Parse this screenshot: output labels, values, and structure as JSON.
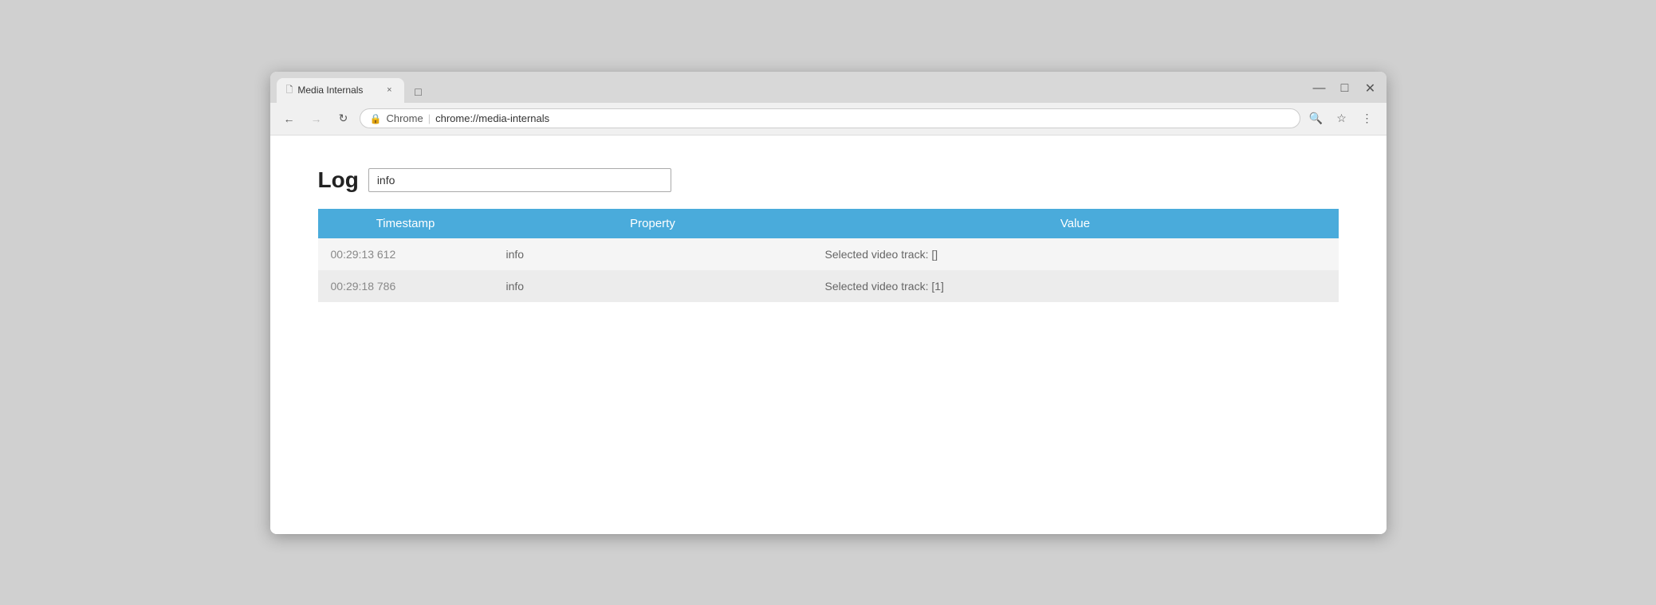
{
  "browser": {
    "title": "Media Internals",
    "url": "chrome://media-internals",
    "url_prefix": "Chrome",
    "tab_close": "×",
    "minimize": "—",
    "maximize": "□",
    "close": "✕"
  },
  "nav": {
    "back_label": "←",
    "forward_label": "→",
    "reload_label": "↻",
    "search_icon": "🔍",
    "star_icon": "☆",
    "menu_icon": "⋮",
    "secure_icon": "🔒"
  },
  "page": {
    "log_label": "Log",
    "filter_placeholder": "",
    "filter_value": "info",
    "table": {
      "headers": [
        "Timestamp",
        "Property",
        "Value"
      ],
      "rows": [
        {
          "timestamp": "00:29:13 612",
          "property": "info",
          "value": "Selected video track: []"
        },
        {
          "timestamp": "00:29:18 786",
          "property": "info",
          "value": "Selected video track: [1]"
        }
      ]
    }
  }
}
